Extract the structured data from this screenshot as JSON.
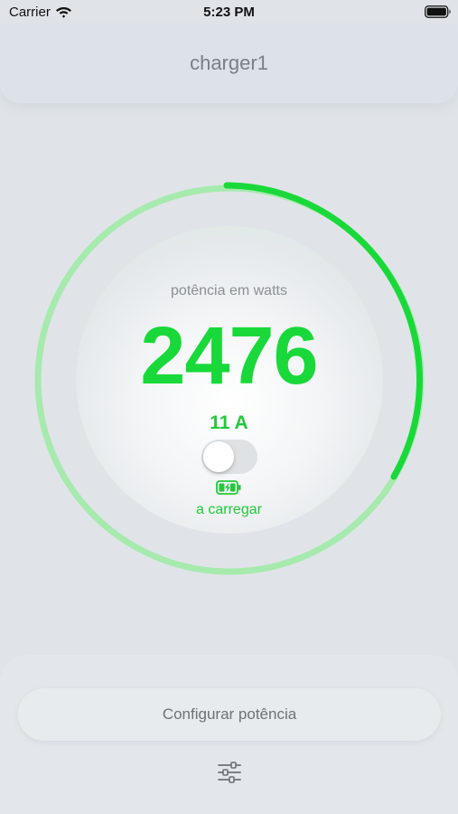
{
  "status_bar": {
    "carrier": "Carrier",
    "time": "5:23 PM",
    "icons": [
      "wifi-icon",
      "battery-icon"
    ]
  },
  "header": {
    "title": "charger1"
  },
  "gauge": {
    "label": "potência em watts",
    "power_watts": "2476",
    "current": "11 A",
    "toggle_on": false,
    "status_icon": "battery-charging-icon",
    "status": "a carregar",
    "accent_color": "#19d93a",
    "track_color": "#a6eaae"
  },
  "bottom": {
    "config_button_label": "Configurar potência",
    "settings_icon": "sliders-icon"
  }
}
